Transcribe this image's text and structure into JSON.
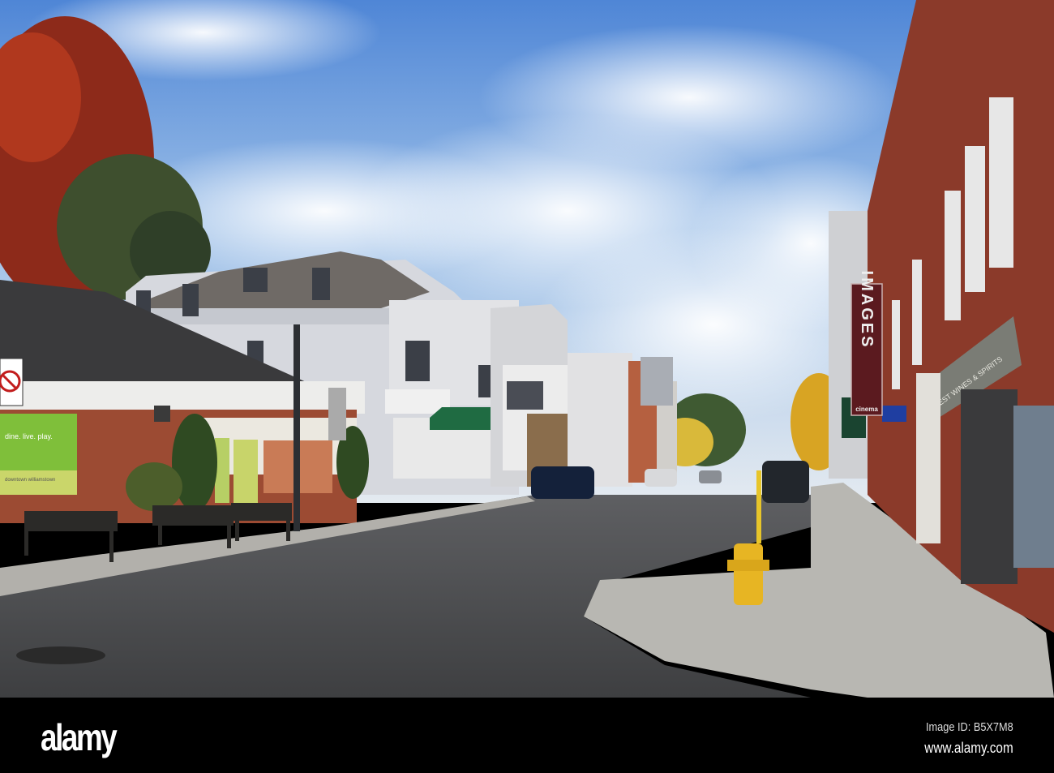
{
  "photo": {
    "cinema_sign": {
      "title": "IMAGES",
      "subtitle": "cinema"
    },
    "awning_text": "WEST WINES & SPIRITS",
    "banner_text": "dine. live. play.",
    "banner_caption": "downtown williamstown"
  },
  "footer": {
    "logo": "alamy",
    "image_id": "Image ID: B5X7M8",
    "website": "www.alamy.com"
  }
}
